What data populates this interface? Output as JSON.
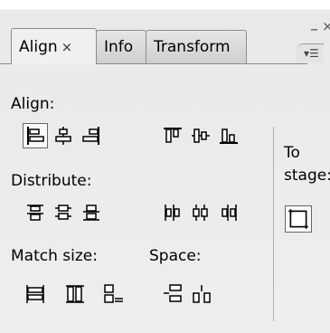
{
  "window": {
    "minimize_glyph": "–",
    "close_glyph": "×"
  },
  "tabs": [
    {
      "label": "Align",
      "close_glyph": "×",
      "active": true
    },
    {
      "label": "Info",
      "active": false
    },
    {
      "label": "Transform",
      "active": false
    }
  ],
  "panel_menu_glyph": "▾☰",
  "sections": {
    "align": "Align:",
    "distribute": "Distribute:",
    "match_size": "Match size:",
    "space": "Space:",
    "to_stage": "To stage:"
  },
  "icons": {
    "align_left_edge": "align-left-edge-icon",
    "align_horizontal_center": "align-horizontal-center-icon",
    "align_right_edge": "align-right-edge-icon",
    "align_top_edge": "align-top-edge-icon",
    "align_vertical_center": "align-vertical-center-icon",
    "align_bottom_edge": "align-bottom-edge-icon",
    "distribute_top": "distribute-top-edge-icon",
    "distribute_vcenter": "distribute-vertical-center-icon",
    "distribute_bottom": "distribute-bottom-edge-icon",
    "distribute_left": "distribute-left-edge-icon",
    "distribute_hcenter": "distribute-horizontal-center-icon",
    "distribute_right": "distribute-right-edge-icon",
    "match_width": "match-width-icon",
    "match_height": "match-height-icon",
    "match_width_height": "match-width-and-height-icon",
    "space_vertical": "space-evenly-vertically-icon",
    "space_horizontal": "space-evenly-horizontally-icon",
    "to_stage": "to-stage-icon"
  }
}
